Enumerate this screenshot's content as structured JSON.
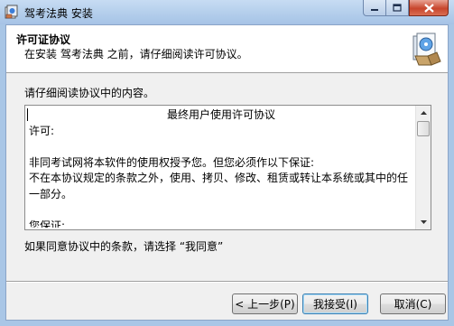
{
  "window": {
    "title": "驾考法典 安装",
    "icon": "installer-app-icon"
  },
  "title_buttons": {
    "minimize": "minimize-icon",
    "maximize": "maximize-icon",
    "close": "close-icon"
  },
  "header": {
    "title": "许可证协议",
    "subtitle": "在安装 驾考法典 之前，请仔细阅读许可协议。",
    "icon": "installer-package-icon"
  },
  "intro_text": "请仔细阅读协议中的内容。",
  "license": {
    "lines": [
      "最终用户使用许可协议",
      "许可:",
      "",
      "非同考试网将本软件的使用权授予您。但您必须作以下保证:",
      "不在本协议规定的条款之外，使用、拷贝、修改、租赁或转让本系统或其中的任",
      "一部分。",
      "",
      "您保证:"
    ]
  },
  "agree_prompt": "如果同意协议中的条款，请选择 “我同意”",
  "buttons": {
    "back": "< 上一步(P)",
    "agree": "我接受(I)",
    "cancel": "取消(C)"
  },
  "colors": {
    "frame": "#a9c6e6",
    "client": "#f0f0f0",
    "default_button_border": "#3c7fb1"
  }
}
